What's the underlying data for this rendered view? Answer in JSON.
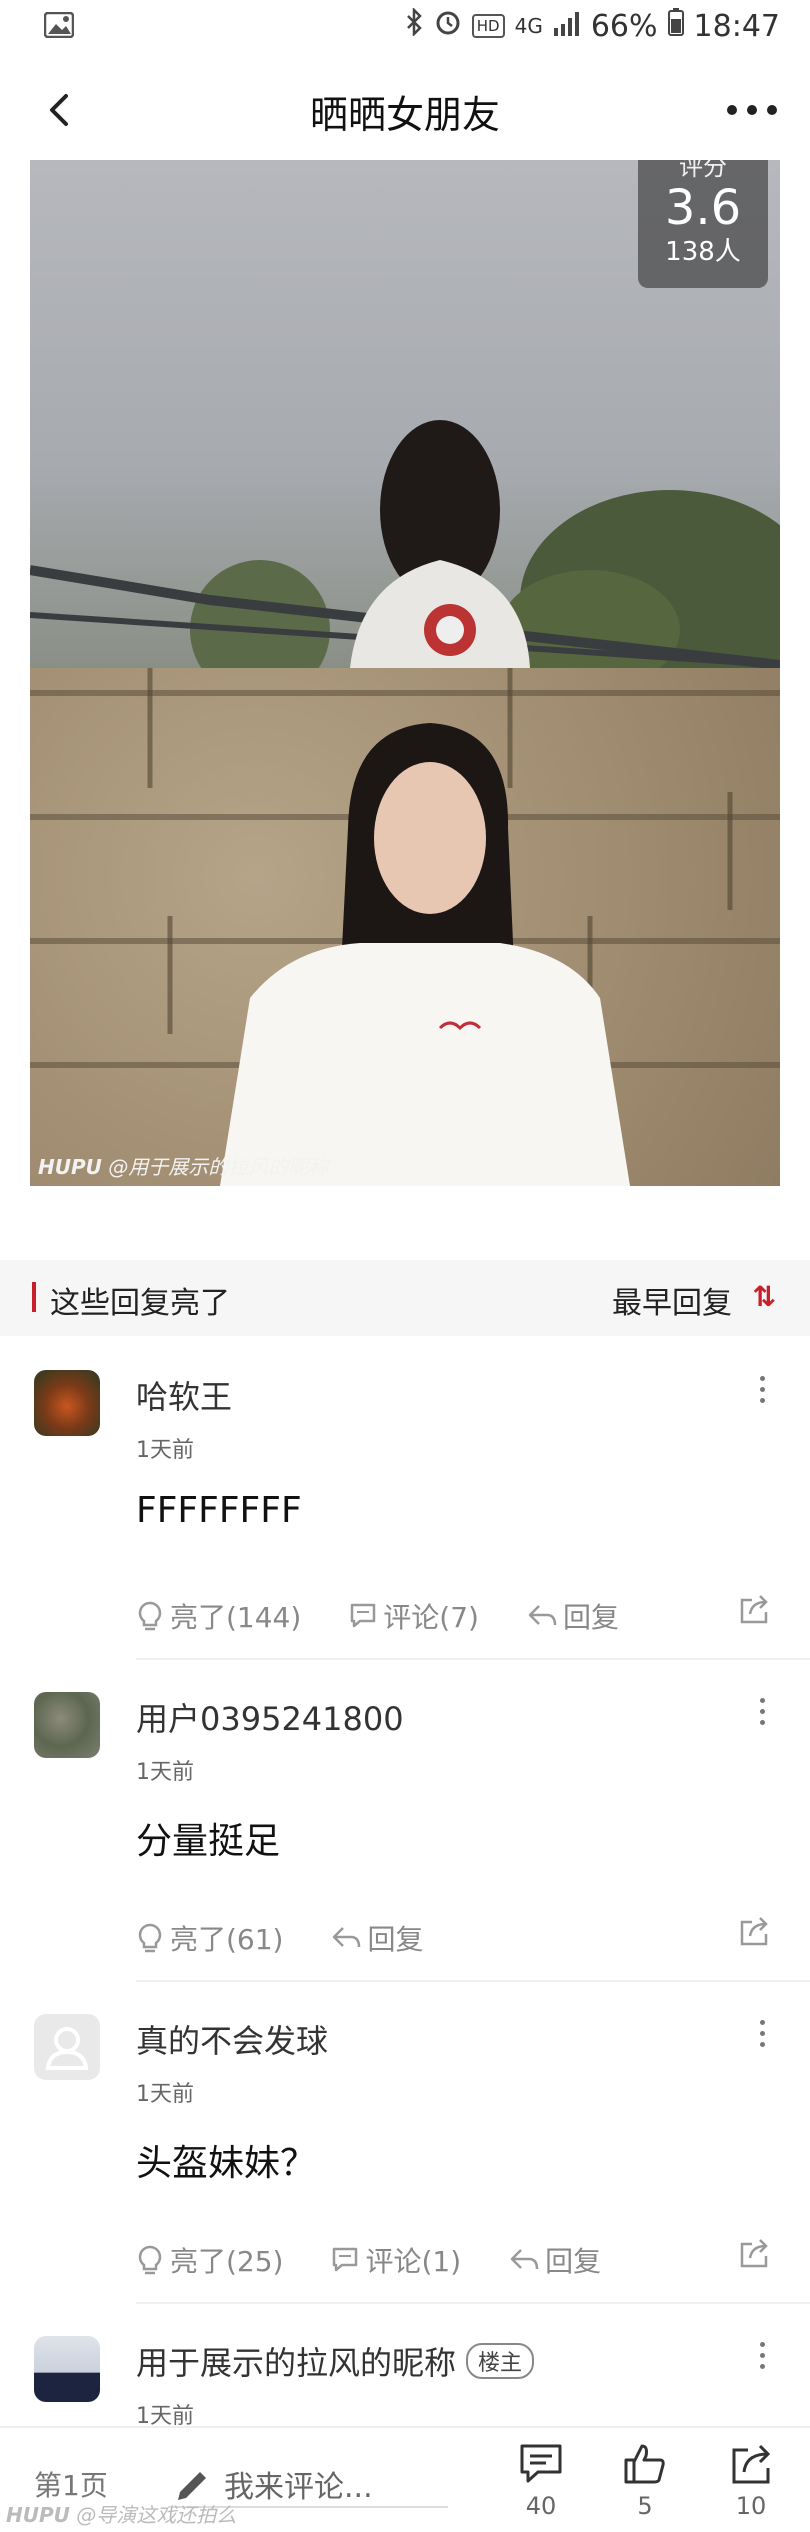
{
  "status_bar": {
    "network": "4G",
    "battery": "66%",
    "time": "18:47",
    "hd": "HD"
  },
  "header": {
    "title": "晒晒女朋友"
  },
  "hero": {
    "rating_label": "评分",
    "rating_score": "3.6",
    "rating_count": "138人",
    "watermark_brand": "HUPU",
    "watermark_text": "@用于展示的拉风的昵称"
  },
  "section": {
    "title": "这些回复亮了",
    "sort_label": "最早回复"
  },
  "comments": [
    {
      "username": "哈软王",
      "time": "1天前",
      "content": "FFFFFFFF",
      "likes": "亮了(144)",
      "comments": "评论(7)",
      "reply": "回复"
    },
    {
      "username": "用户0395241800",
      "time": "1天前",
      "content": "分量挺足",
      "likes": "亮了(61)",
      "reply": "回复"
    },
    {
      "username": "真的不会发球",
      "time": "1天前",
      "content": "头盔妹妹？",
      "likes": "亮了(25)",
      "comments": "评论(1)",
      "reply": "回复"
    },
    {
      "username": "用于展示的拉风的昵称",
      "op_badge": "楼主",
      "time": "1天前"
    }
  ],
  "bottom_bar": {
    "page": "第1页",
    "comment_placeholder": "我来评论...",
    "reply_count": "40",
    "like_count": "5",
    "share_count": "10",
    "watermark_brand": "HUPU",
    "watermark_text": "@导演这戏还拍么"
  },
  "colors": {
    "accent": "#c8202a",
    "muted_text": "#888888"
  }
}
